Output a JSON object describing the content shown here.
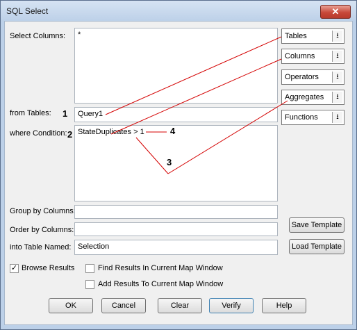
{
  "window": {
    "title": "SQL Select",
    "close_label": "✕"
  },
  "labels": {
    "select_columns": "Select Columns:",
    "from_tables": "from Tables:",
    "where_condition": "where Condition:",
    "group_by": "Group by Columns:",
    "order_by": "Order by Columns:",
    "into_table": "into Table Named:"
  },
  "fields": {
    "select_columns": "*",
    "from_tables": "Query1",
    "where_condition": "StateDuplicates > 1",
    "group_by": "",
    "order_by": "",
    "into_table": "Selection"
  },
  "dropdowns": [
    {
      "label": "Tables"
    },
    {
      "label": "Columns"
    },
    {
      "label": "Operators"
    },
    {
      "label": "Aggregates"
    },
    {
      "label": "Functions"
    }
  ],
  "side_buttons": {
    "save_template": "Save Template",
    "load_template": "Load Template"
  },
  "checkboxes": {
    "browse_results": {
      "label": "Browse Results",
      "checked": true
    },
    "find_results": {
      "label": "Find Results In Current Map Window",
      "checked": false
    },
    "add_results": {
      "label": "Add Results To Current Map Window",
      "checked": false
    }
  },
  "buttons": {
    "ok": "OK",
    "cancel": "Cancel",
    "clear": "Clear",
    "verify": "Verify",
    "help": "Help"
  },
  "annotations": {
    "n1": "1",
    "n2": "2",
    "n3": "3",
    "n4": "4"
  },
  "colors": {
    "annotation_line": "#d40000",
    "title_bar": "#bcd0e8",
    "close_button": "#c8493a"
  }
}
